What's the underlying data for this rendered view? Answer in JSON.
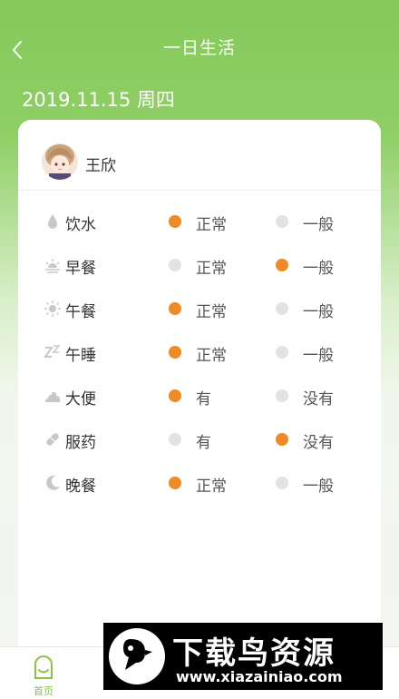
{
  "header": {
    "title": "一日生活",
    "date": "2019.11.15 周四"
  },
  "user": {
    "name": "王欣"
  },
  "rows": [
    {
      "label": "饮水",
      "icon": "water-drop-icon",
      "opt1": "正常",
      "opt2": "一般",
      "selected": 1
    },
    {
      "label": "早餐",
      "icon": "sunrise-icon",
      "opt1": "正常",
      "opt2": "一般",
      "selected": 2
    },
    {
      "label": "午餐",
      "icon": "sun-icon",
      "opt1": "正常",
      "opt2": "一般",
      "selected": 1
    },
    {
      "label": "午睡",
      "icon": "sleep-icon",
      "opt1": "正常",
      "opt2": "一般",
      "selected": 1
    },
    {
      "label": "大便",
      "icon": "stool-icon",
      "opt1": "有",
      "opt2": "没有",
      "selected": 1
    },
    {
      "label": "服药",
      "icon": "pill-icon",
      "opt1": "有",
      "opt2": "没有",
      "selected": 2
    },
    {
      "label": "晚餐",
      "icon": "moon-icon",
      "opt1": "正常",
      "opt2": "一般",
      "selected": 1
    }
  ],
  "tabbar": {
    "home_label": "首页"
  },
  "watermark": {
    "title": "下载鸟资源",
    "url": "www.xiazainiao.com"
  },
  "colors": {
    "accent": "#f08a24",
    "inactive": "#e2e2e2",
    "header_green": "#85c95a"
  }
}
